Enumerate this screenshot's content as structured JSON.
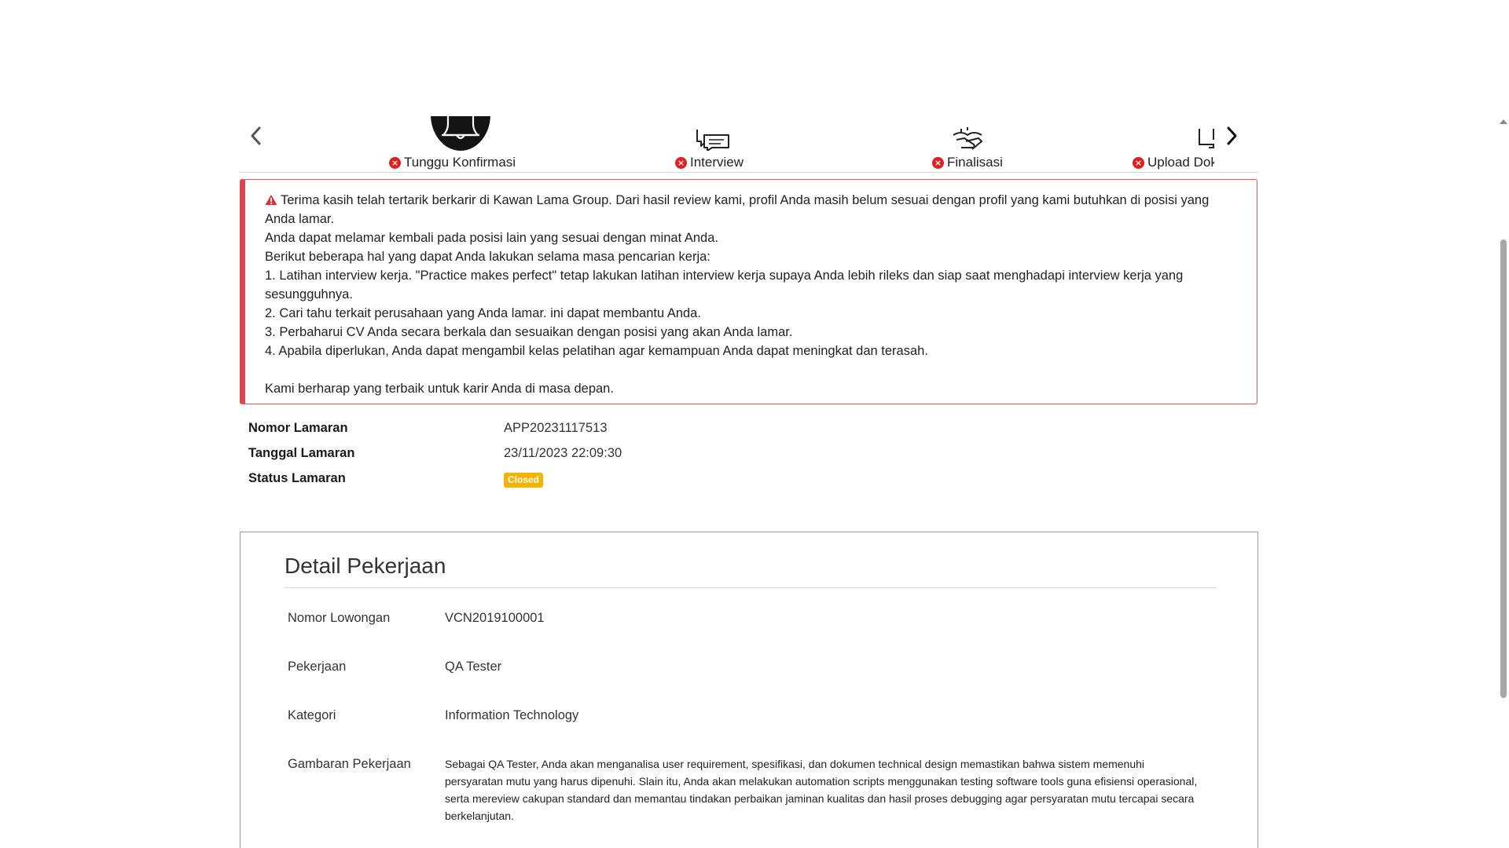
{
  "stepper": {
    "steps": [
      {
        "label": "Tunggu Konfirmasi",
        "icon": "bell-icon",
        "status": "error"
      },
      {
        "label": "Interview",
        "icon": "chat-bubbles-icon",
        "status": "error"
      },
      {
        "label": "Finalisasi",
        "icon": "handshake-icon",
        "status": "error"
      },
      {
        "label": "Upload Dokumen Pelengkap",
        "icon": "monitor-upload-icon",
        "status": "error"
      }
    ],
    "prev_icon": "chevron-left-icon",
    "next_icon": "chevron-right-icon"
  },
  "alert": {
    "icon": "warning-triangle-icon",
    "color": "#e0454e",
    "line1": "Terima kasih telah tertarik berkarir di Kawan Lama Group. Dari hasil review kami, profil Anda masih belum sesuai dengan profil yang kami butuhkan di posisi yang Anda lamar.",
    "line2": "Anda dapat melamar kembali pada posisi lain yang sesuai dengan minat Anda.",
    "line3": "Berikut beberapa hal yang dapat Anda lakukan selama masa pencarian kerja:",
    "tip1": "1. Latihan interview kerja. \"Practice makes perfect\" tetap lakukan latihan interview kerja supaya Anda lebih rileks dan siap saat menghadapi interview kerja yang sesungguhnya.",
    "tip2": "2. Cari tahu terkait perusahaan yang Anda lamar. ini dapat membantu Anda.",
    "tip3": "3. Perbaharui CV Anda secara berkala dan sesuaikan dengan posisi yang akan Anda lamar.",
    "tip4": "4. Apabila diperlukan, Anda dapat mengambil kelas pelatihan agar kemampuan Anda dapat meningkat dan terasah.",
    "closing": "Kami berharap yang terbaik untuk karir Anda di masa depan."
  },
  "summary": {
    "nomor_label": "Nomor Lamaran",
    "nomor_value": "APP20231117513",
    "tanggal_label": "Tanggal Lamaran",
    "tanggal_value": "23/11/2023 22:09:30",
    "status_label": "Status Lamaran",
    "status_value": "Closed",
    "status_color": "#f2b400"
  },
  "detail": {
    "title": "Detail Pekerjaan",
    "rows": [
      {
        "label": "Nomor Lowongan",
        "value": "VCN2019100001"
      },
      {
        "label": "Pekerjaan",
        "value": "QA Tester"
      },
      {
        "label": "Kategori",
        "value": "Information Technology"
      },
      {
        "label": "Gambaran Pekerjaan",
        "value": "Sebagai QA Tester, Anda akan menganalisa user requirement, spesifikasi, dan dokumen technical design memastikan bahwa sistem memenuhi persyaratan mutu yang harus dipenuhi. Slain itu, Anda akan melakukan automation scripts menggunakan testing software tools guna efisiensi operasional, serta mereview cakupan standard dan memantau tindakan perbaikan jaminan kualitas dan hasil proses debugging agar persyaratan mutu tercapai secara berkelanjutan."
      }
    ]
  }
}
